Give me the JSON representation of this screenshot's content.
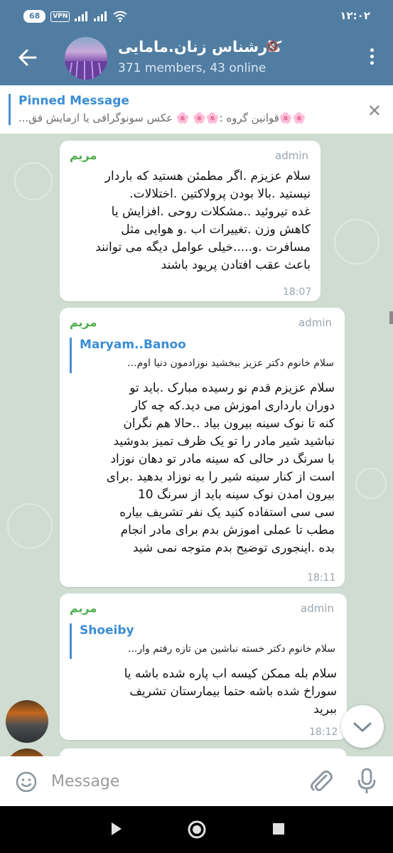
{
  "status": {
    "battery": "68",
    "vpn": "VPN",
    "time": "۱۲:۰۲"
  },
  "header": {
    "title": "کارشناس زنان.مامایی",
    "subtitle": "371 members, 43 online"
  },
  "pinned": {
    "title": "Pinned Message",
    "text": "🌸🌸قوانین گروه :🌸🌸 🌸 عکس سونوگرافی یا ازمایش فق..."
  },
  "messages": [
    {
      "sender": "مریم",
      "role": "admin",
      "text": "سلام عزیزم .اگر مطمئن هستید که باردار\nنیستید .بالا بودن پرولاکتین .اختلالات.\nغده تیروئید ..مشکلات روحی .افزایش یا\nکاهش وزن .تغییرات اب .و هوایی مثل\nمسافرت .و.....خیلی عوامل دیگه می توانند\nباعث عقب افتادن پریود باشند",
      "time": "18:07"
    },
    {
      "sender": "مریم",
      "role": "admin",
      "reply_name": "Maryam..Banoo",
      "reply_text": "سلام خانوم دکتر عزیز ببخشید نوزادمون دنیا اوم...",
      "text": "سلام عزیزم قدم نو رسیده مبارک .باید تو\nدوران بارداری اموزش می دید.که چه کار\nکنه تا نوک سینه بیرون بیاد ..حالا هم نگران\nنباشید شیر مادر را تو یک ظرف تمیز بدوشید\nبا سرنگ در حالی که سینه مادر تو دهان نوزاد\nاست از کنار سینه شیر را به نوزاد بدهید .برای\nبیرون امدن نوک سینه باید از سرنگ 10\nسی سی استفاده کنید یک نفر تشریف بیاره\nمطب تا عملی اموزش بدم برای مادر انجام\nبده .اینجوری توضیح بدم متوجه نمی شید",
      "time": "18:11"
    },
    {
      "sender": "مریم",
      "role": "admin",
      "reply_name": "Shoeiby",
      "reply_text": "سلام خانوم دکتر خسته نباشین  من تازه رفتم وار...",
      "text": "سلام بله ممکن کیسه اب پاره شده باشه یا\nسوراخ شده باشه حتما بیمارستان تشریف\nببرید",
      "time": "18:12"
    }
  ],
  "input": {
    "placeholder": "Message"
  },
  "colors": {
    "header": "#517da2",
    "sender": "#4fae4e",
    "link": "#3a8dd4",
    "chat_bg": "#cfdcd2"
  }
}
